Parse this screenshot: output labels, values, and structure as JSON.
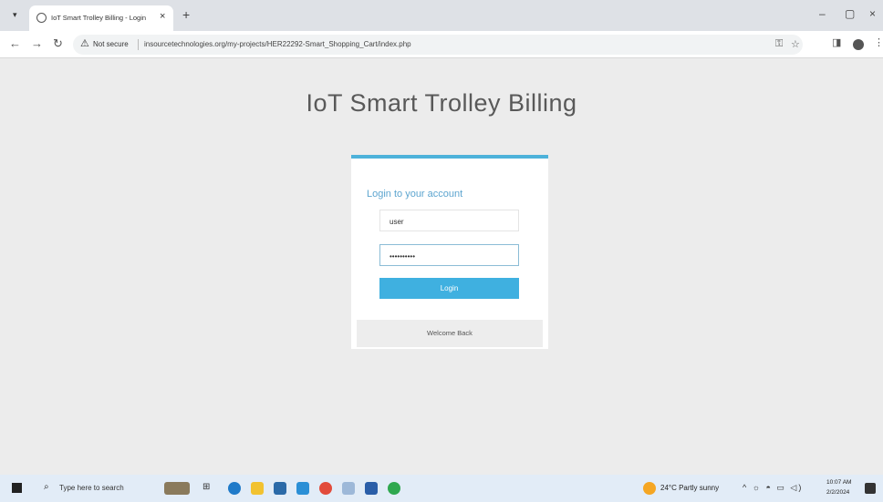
{
  "browser": {
    "tab_title": "IoT Smart Trolley Billing - Login",
    "new_tab_icon": "+",
    "security_label": "Not secure",
    "url": "insourcetechnologies.org/my-projects/HER22292-Smart_Shopping_Cart/index.php"
  },
  "page": {
    "heading": "IoT Smart Trolley Billing",
    "login_title": "Login to your account",
    "username_value": "user",
    "password_value": "••••••••••",
    "login_button": "Login",
    "footer_text": "Welcome Back"
  },
  "taskbar": {
    "search_placeholder": "Type here to search",
    "weather": "24°C  Partly sunny",
    "time": "10:07 AM",
    "date": "2/2/2024"
  },
  "colors": {
    "accent": "#3fb0e0",
    "heading": "#595959",
    "background": "#ececec"
  }
}
